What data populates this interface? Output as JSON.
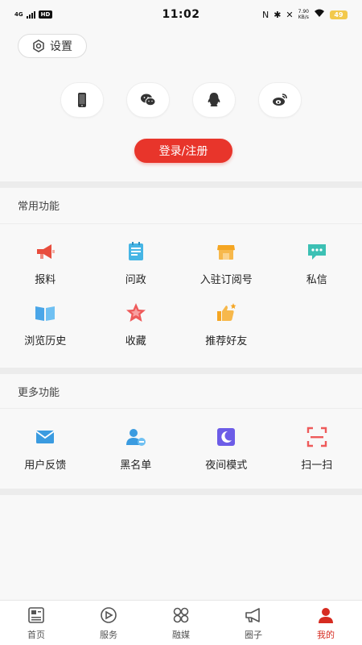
{
  "status_bar": {
    "network": "4G",
    "hd": "HD",
    "time": "11:02",
    "speed_value": "7.90",
    "speed_unit": "KB/s",
    "battery": "49"
  },
  "settings": {
    "label": "设置"
  },
  "social": {
    "items": [
      {
        "icon": "phone-icon"
      },
      {
        "icon": "wechat-icon"
      },
      {
        "icon": "qq-icon"
      },
      {
        "icon": "weibo-icon"
      }
    ]
  },
  "login": {
    "label": "登录/注册"
  },
  "common": {
    "title": "常用功能",
    "items": [
      {
        "label": "报料",
        "icon": "megaphone-icon"
      },
      {
        "label": "问政",
        "icon": "notepad-icon"
      },
      {
        "label": "入驻订阅号",
        "icon": "store-icon"
      },
      {
        "label": "私信",
        "icon": "chat-icon"
      },
      {
        "label": "浏览历史",
        "icon": "book-icon"
      },
      {
        "label": "收藏",
        "icon": "star-icon"
      },
      {
        "label": "推荐好友",
        "icon": "thumbs-up-icon"
      }
    ]
  },
  "more": {
    "title": "更多功能",
    "items": [
      {
        "label": "用户反馈",
        "icon": "mail-icon"
      },
      {
        "label": "黑名单",
        "icon": "user-block-icon"
      },
      {
        "label": "夜间模式",
        "icon": "moon-icon"
      },
      {
        "label": "扫一扫",
        "icon": "scan-icon"
      }
    ]
  },
  "tabbar": {
    "items": [
      {
        "label": "首页",
        "icon": "news-icon"
      },
      {
        "label": "服务",
        "icon": "service-icon"
      },
      {
        "label": "融媒",
        "icon": "grid-icon"
      },
      {
        "label": "圈子",
        "icon": "horn-icon"
      },
      {
        "label": "我的",
        "icon": "user-icon"
      }
    ],
    "active_index": 4
  },
  "colors": {
    "accent": "#e8352b",
    "active_tab": "#d62b20"
  }
}
